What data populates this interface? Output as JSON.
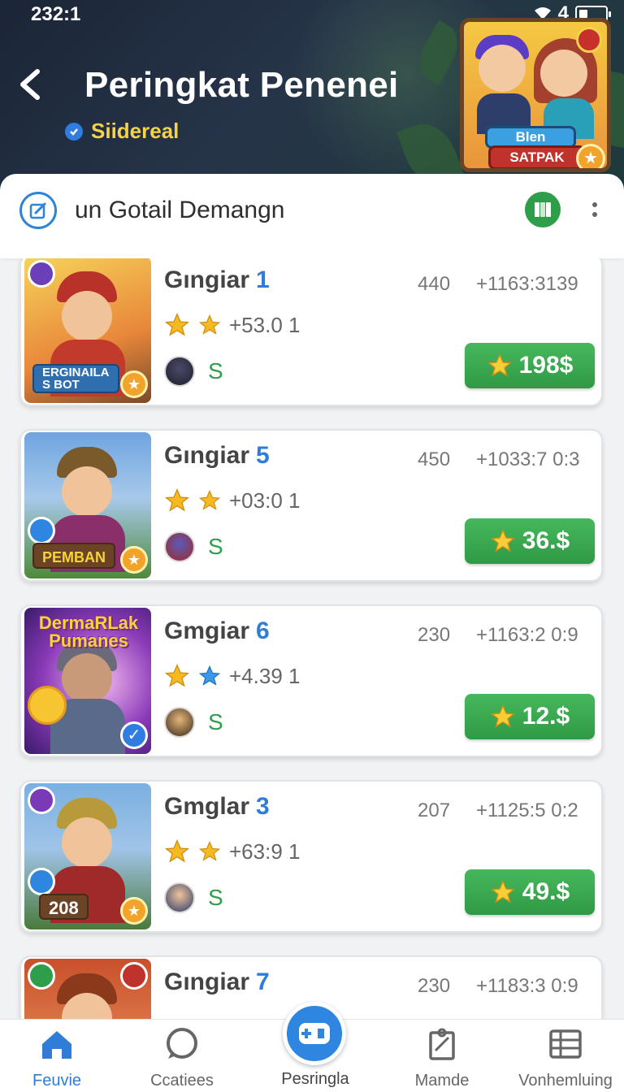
{
  "status_bar": {
    "time": "232:1",
    "signal": "4"
  },
  "header": {
    "title": "Peringkat Penenei",
    "subtitle": "Siidereal",
    "banner": {
      "plate_top": "Blen",
      "plate_bottom": "SATPAK"
    }
  },
  "section": {
    "title": "un Gotail Demangn"
  },
  "players": [
    {
      "name": "Gıngiar",
      "rank": "1",
      "score": "440",
      "code": "+1163:3139",
      "rating": "+53.0 1",
      "avatar_label": "S",
      "prize": "198$",
      "thumb_text": "ERGINAILA\nS BOT"
    },
    {
      "name": "Gıngiar",
      "rank": "5",
      "score": "450",
      "code": "+1033:7 0:3",
      "rating": "+03:0 1",
      "avatar_label": "S",
      "prize": "36.$",
      "thumb_text": "PEMBAN"
    },
    {
      "name": "Gmgiar",
      "rank": "6",
      "score": "230",
      "code": "+1163:2 0:9",
      "rating": "+4.39 1",
      "avatar_label": "S",
      "prize": "12.$",
      "thumb_text": "DermaRLak Pumanes"
    },
    {
      "name": "Gmglar",
      "rank": "3",
      "score": "207",
      "code": "+1125:5 0:2",
      "rating": "+63:9 1",
      "avatar_label": "S",
      "prize": "49.$",
      "thumb_text": "208"
    },
    {
      "name": "Gıngiar",
      "rank": "7",
      "score": "230",
      "code": "+1183:3 0:9"
    }
  ],
  "nav": {
    "items": [
      {
        "label": "Feuvie"
      },
      {
        "label": "Ccatiees"
      },
      {
        "label": "Pesringla"
      },
      {
        "label": "Mamde"
      },
      {
        "label": "Vonhemluing"
      }
    ]
  },
  "colors": {
    "accent_blue": "#2f7dd6",
    "prize_green": "#2f9a45",
    "subtitle_gold": "#f4d24a",
    "header_bg": "#1b2536"
  }
}
